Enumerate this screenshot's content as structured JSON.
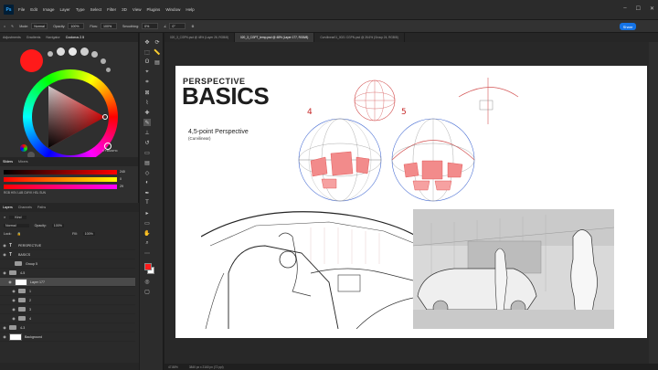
{
  "menubar": {
    "logo": "Ps",
    "items": [
      "File",
      "Edit",
      "Image",
      "Layer",
      "Type",
      "Select",
      "Filter",
      "3D",
      "View",
      "Plugins",
      "Window",
      "Help"
    ]
  },
  "options": {
    "mode_label": "Mode:",
    "mode_value": "Normal",
    "opacity_label": "Opacity:",
    "opacity_value": "100%",
    "flow_label": "Flow:",
    "flow_value": "100%",
    "smoothing_label": "Smoothing:",
    "smoothing_value": "0%",
    "angle_value": "0°",
    "share_label": "Share"
  },
  "left_tabs": [
    "Adjustments",
    "Gradients",
    "Navigator",
    "Coolorus 2.5"
  ],
  "color_panel": {
    "brand": "© TRIANTIC",
    "sliders_tabs": [
      "Sliders",
      "Mixers"
    ],
    "r_value": "240",
    "g_value": "0",
    "b_value": "29",
    "modes": "RGB  HSV  LAB  CMYK  HSL  SUN"
  },
  "layers_panel": {
    "tabs": [
      "Layers",
      "Channels",
      "Paths"
    ],
    "kind_label": "Kind",
    "blend_value": "Normal",
    "opacity_label": "Opacity:",
    "opacity_value": "100%",
    "lock_label": "Lock:",
    "fill_label": "Fill:",
    "fill_value": "100%",
    "layers": [
      {
        "name": "PERSPECTIVE",
        "type": "text"
      },
      {
        "name": "BASICS",
        "type": "text"
      },
      {
        "name": "Group 5",
        "type": "folder"
      },
      {
        "name": "4-5",
        "type": "folder"
      },
      {
        "name": "Layer 177",
        "type": "pixel"
      },
      {
        "name": "1",
        "type": "folder"
      },
      {
        "name": "2",
        "type": "folder"
      },
      {
        "name": "3",
        "type": "folder"
      },
      {
        "name": "4",
        "type": "folder"
      },
      {
        "name": "4-3",
        "type": "folder"
      },
      {
        "name": "Background",
        "type": "pixel"
      }
    ]
  },
  "doc_tabs": [
    "020_3_CGPN.psd @ 48% (Layer 26, RGB/8)",
    "020_3_CGPT_temp.psd @ 48% (Layer 177, RGB/8)",
    "Curvilinear01_0021 CGPN.psd @ 26.6% (Group 24, RGB/8)"
  ],
  "canvas": {
    "title_small": "PERSPECTIVE",
    "title_big": "BASICS",
    "subtitle": "4,5-point Perspective",
    "subtitle2": "(Curvilinear)",
    "num4": "4",
    "num5": "5"
  },
  "status": {
    "zoom": "47.88%",
    "dims": "3840 px x 2160 px (72 ppi)"
  },
  "colors": {
    "accent_red": "#ff1a1a",
    "brand_blue": "#1473e6"
  }
}
